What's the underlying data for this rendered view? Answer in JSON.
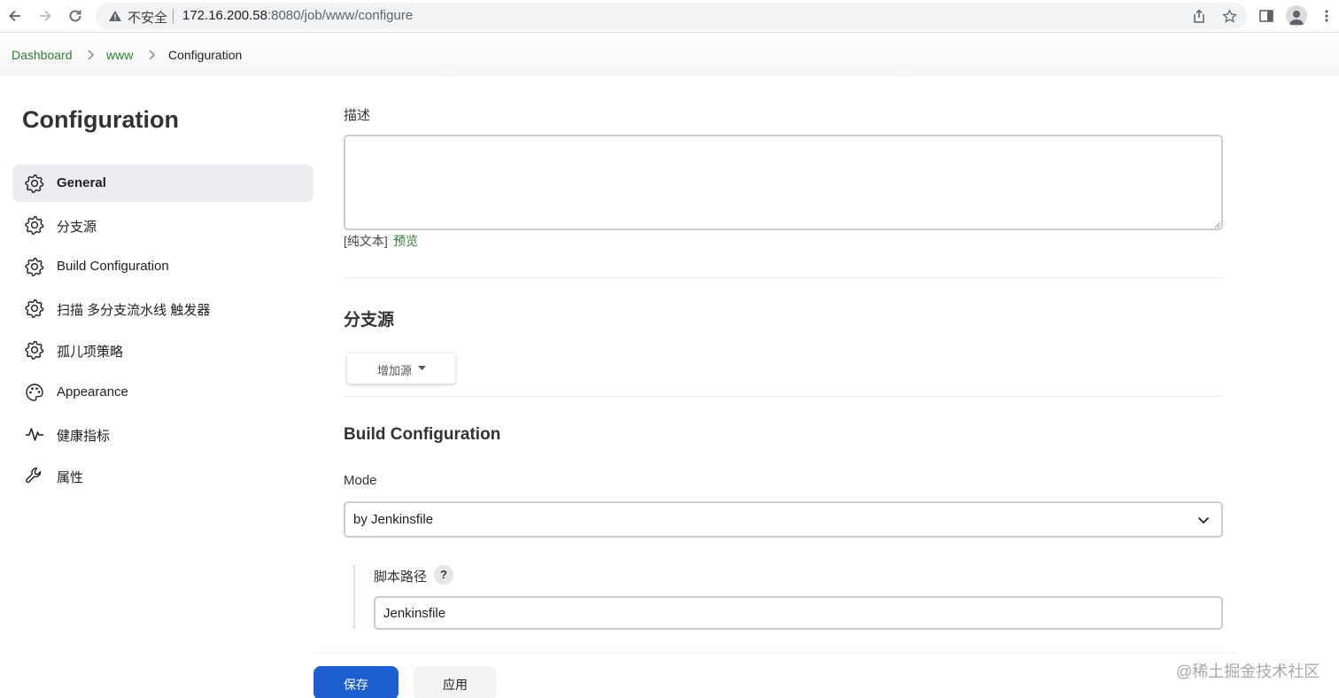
{
  "browser": {
    "security_label": "不安全",
    "url_host": "172.16.200.58",
    "url_rest": ":8080/job/www/configure"
  },
  "breadcrumb": {
    "items": [
      "Dashboard",
      "www",
      "Configuration"
    ]
  },
  "sidebar": {
    "title": "Configuration",
    "items": [
      {
        "label": "General",
        "icon": "gear-icon",
        "active": true
      },
      {
        "label": "分支源",
        "icon": "gear-icon"
      },
      {
        "label": "Build Configuration",
        "icon": "gear-icon"
      },
      {
        "label": "扫描 多分支流水线 触发器",
        "icon": "gear-icon"
      },
      {
        "label": "孤儿项策略",
        "icon": "gear-icon"
      },
      {
        "label": "Appearance",
        "icon": "palette-icon"
      },
      {
        "label": "健康指标",
        "icon": "pulse-icon"
      },
      {
        "label": "属性",
        "icon": "wrench-icon"
      }
    ]
  },
  "main": {
    "description": {
      "label": "描述",
      "value": "",
      "plain_text_label": "[纯文本]",
      "preview_link": "预览"
    },
    "branch_sources": {
      "title": "分支源",
      "add_button": "增加源"
    },
    "build_configuration": {
      "title": "Build Configuration",
      "mode_label": "Mode",
      "mode_value": "by Jenkinsfile",
      "script_path_label": "脚本路径",
      "help_label": "?",
      "script_path_value": "Jenkinsfile"
    }
  },
  "footer": {
    "save_label": "保存",
    "apply_label": "应用"
  },
  "watermark": "@稀土掘金技术社区",
  "colors": {
    "link": "#2e7d32",
    "primary_button": "#1e5fcf",
    "active_nav": "#ececf1"
  }
}
